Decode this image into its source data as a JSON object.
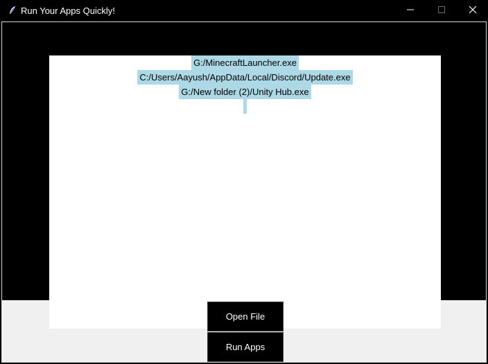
{
  "window": {
    "title": "Run Your Apps Quickly!",
    "icon": "feather-icon",
    "controls": [
      "minimize-icon",
      "maximize-icon",
      "close-icon"
    ]
  },
  "listbox": {
    "items": [
      "G:/MinecraftLauncher.exe",
      "C:/Users/Aayush/AppData/Local/Discord/Update.exe",
      "G:/New folder (2)/Unity Hub.exe",
      ""
    ],
    "highlight_color": "#add8e6"
  },
  "buttons": {
    "open_file": "Open File",
    "run_apps": "Run Apps"
  },
  "colors": {
    "background": "#000000",
    "bottom_band": "#f0f0f0",
    "list_background": "#ffffff",
    "button_background": "#000000",
    "button_text": "#ffffff"
  }
}
